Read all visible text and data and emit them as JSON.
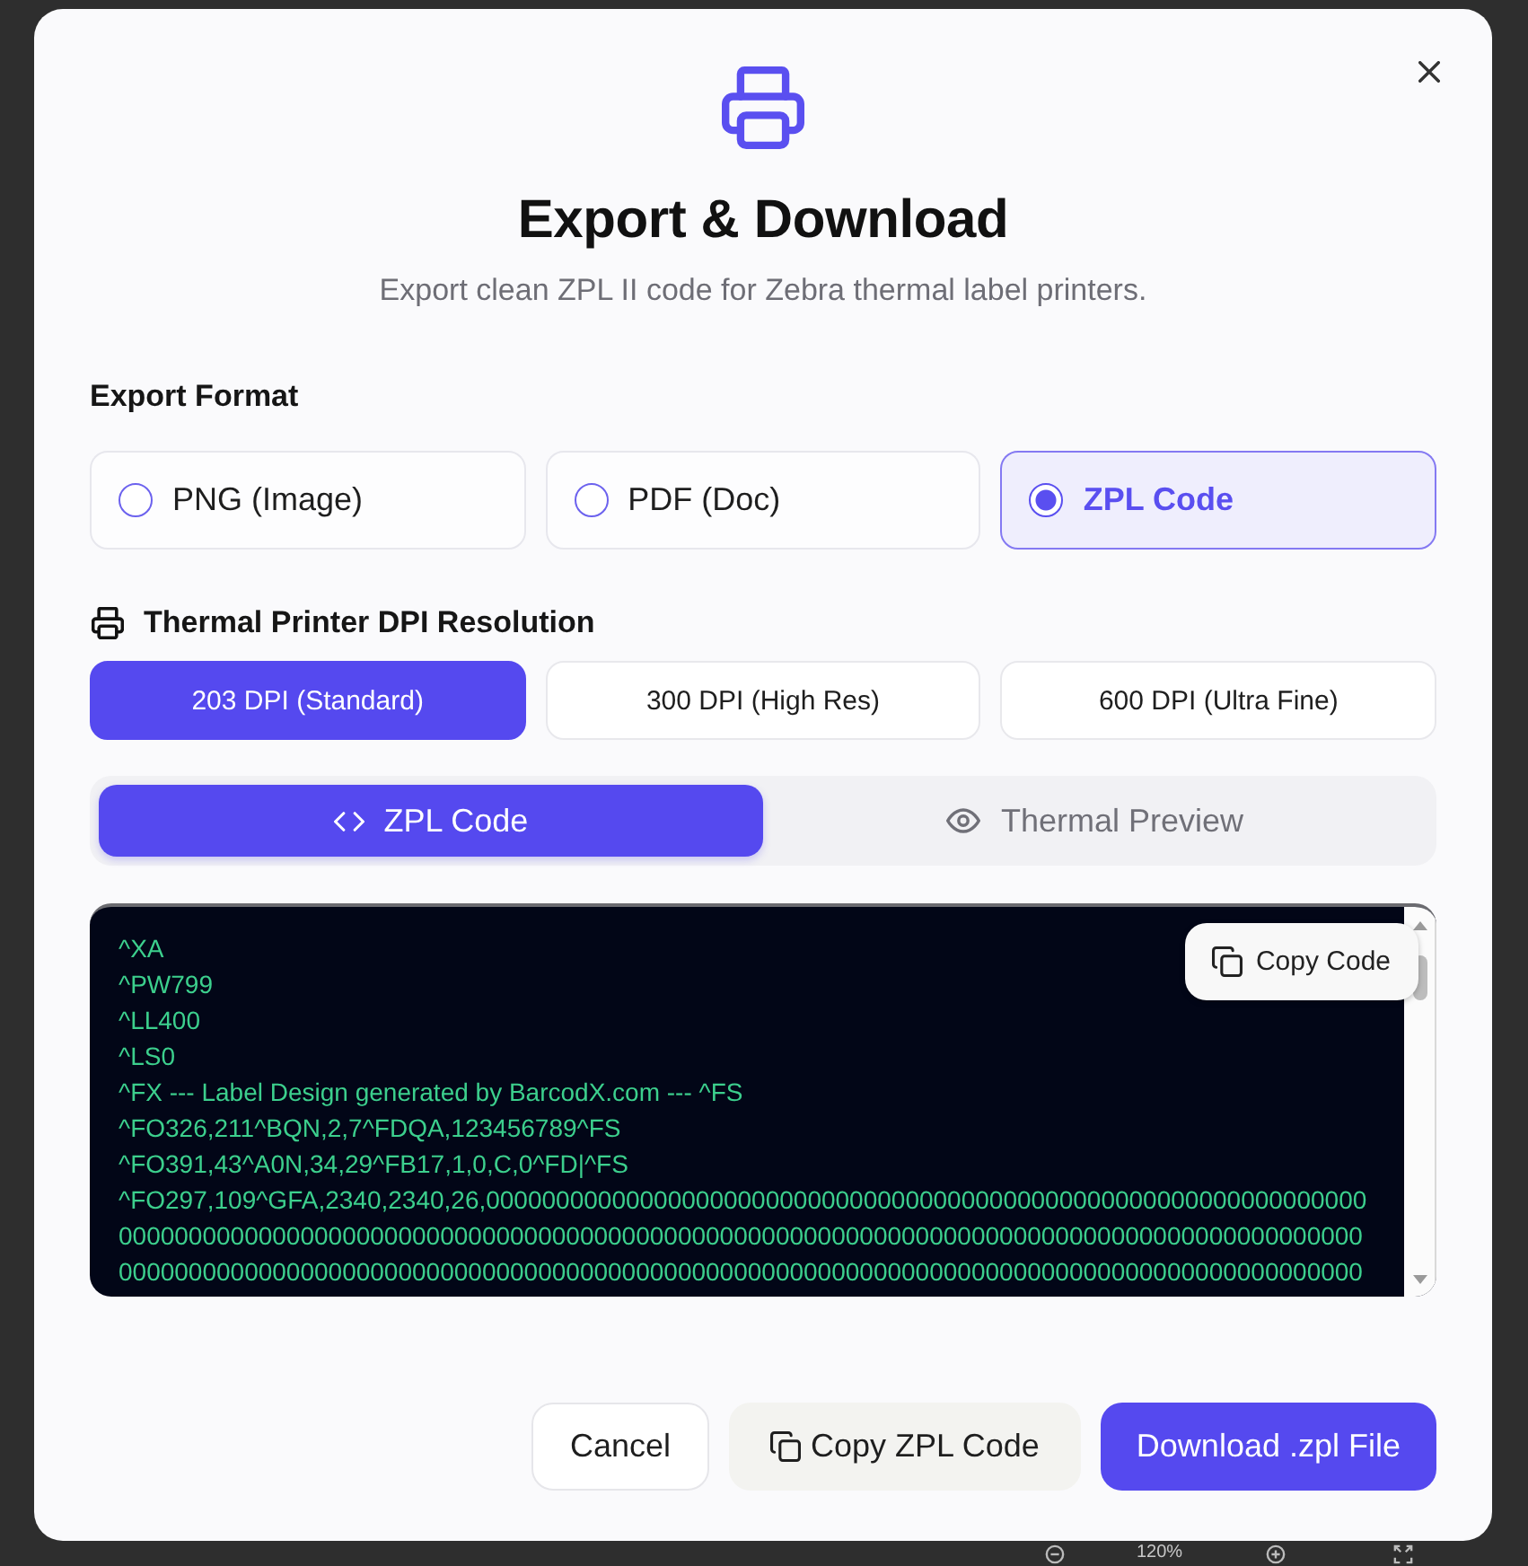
{
  "dialog": {
    "title": "Export & Download",
    "subtitle": "Export clean ZPL II code for Zebra thermal label printers."
  },
  "export_format": {
    "label": "Export Format",
    "options": [
      {
        "label": "PNG (Image)",
        "selected": false
      },
      {
        "label": "PDF (Doc)",
        "selected": false
      },
      {
        "label": "ZPL Code",
        "selected": true
      }
    ]
  },
  "dpi": {
    "label": "Thermal Printer DPI Resolution",
    "options": [
      {
        "label": "203 DPI (Standard)",
        "selected": true
      },
      {
        "label": "300 DPI (High Res)",
        "selected": false
      },
      {
        "label": "600 DPI (Ultra Fine)",
        "selected": false
      }
    ]
  },
  "view_tabs": [
    {
      "label": "ZPL Code",
      "kind": "code",
      "selected": true
    },
    {
      "label": "Thermal Preview",
      "kind": "preview",
      "selected": false
    }
  ],
  "code": {
    "copy_button": "Copy Code",
    "lines": [
      "^XA",
      "^PW799",
      "^LL400",
      "^LS0",
      "^FX --- Label Design generated by BarcodX.com --- ^FS",
      "^FO326,211^BQN,2,7^FDQA,123456789^FS",
      "^FO391,43^A0N,34,29^FB17,1,0,C,0^FD|^FS",
      "^FO297,109^GFA,2340,2340,26,000000000000000000000000000000000000000000000000000000000000000",
      "00000000000000000000000000000000000000000000000000000000000000000000000000000000000000000",
      "00000000000000000000000000000000000000000000000000000000000000000000000000000000000000000"
    ]
  },
  "buttons": [
    {
      "label": "Cancel",
      "kind": "cancel"
    },
    {
      "label": "Copy ZPL Code",
      "kind": "copy"
    },
    {
      "label": "Download .zpl File",
      "kind": "primary"
    }
  ],
  "zoom_bar": {
    "zoom_label": "120%"
  }
}
